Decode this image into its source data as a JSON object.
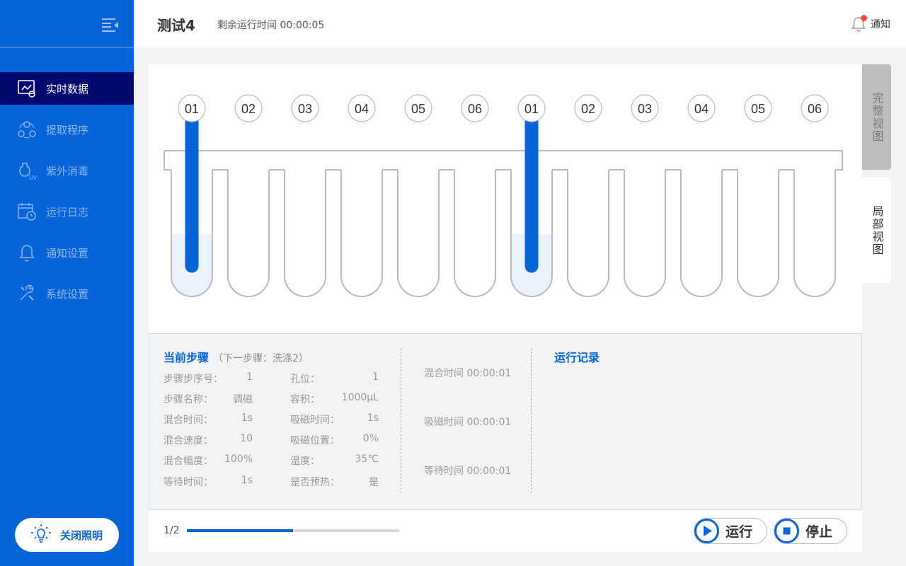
{
  "sidebar": {
    "items": [
      {
        "label": "实时数据",
        "icon": "realtime-data-icon",
        "active": true
      },
      {
        "label": "提取程序",
        "icon": "extraction-program-icon",
        "active": false
      },
      {
        "label": "紫外消毒",
        "icon": "uv-disinfection-icon",
        "active": false
      },
      {
        "label": "运行日志",
        "icon": "calendar-clock-icon",
        "active": false
      },
      {
        "label": "通知设置",
        "icon": "bell-icon",
        "active": false
      },
      {
        "label": "系统设置",
        "icon": "tools-icon",
        "active": false
      }
    ],
    "light_button": "关闭照明"
  },
  "header": {
    "title": "测试4",
    "remaining": "剩余运行时间 00:00:05",
    "notify": "通知"
  },
  "view_tabs": {
    "full": "完整视图",
    "local": "局部视图"
  },
  "wells": {
    "labels": [
      "01",
      "02",
      "03",
      "04",
      "05",
      "06",
      "01",
      "02",
      "03",
      "04",
      "05",
      "06"
    ],
    "active_indices": [
      0,
      6
    ],
    "liquid_indices": [
      0,
      6
    ]
  },
  "step": {
    "title": "当前步骤",
    "next": "（下一步骤：洗涤2）",
    "left": [
      {
        "key": "步骤步序号：",
        "value": "1"
      },
      {
        "key": "步骤名称：",
        "value": "调磁"
      },
      {
        "key": "混合时间：",
        "value": "1s"
      },
      {
        "key": "混合速度：",
        "value": "10"
      },
      {
        "key": "混合幅度：",
        "value": "100%"
      },
      {
        "key": "等待时间：",
        "value": "1s"
      }
    ],
    "right": [
      {
        "key": "孔位：",
        "value": "1"
      },
      {
        "key": "容积：",
        "value": "1000μL"
      },
      {
        "key": "吸磁时间：",
        "value": "1s"
      },
      {
        "key": "吸磁位置：",
        "value": "0%"
      },
      {
        "key": "温度：",
        "value": "35℃"
      },
      {
        "key": "是否预热：",
        "value": "是"
      }
    ]
  },
  "timers": [
    "混合时间 00:00:01",
    "吸磁时间 00:00:01",
    "等待时间 00:00:01"
  ],
  "log_title": "运行记录",
  "footer": {
    "page": "1/2",
    "progress": 0.5,
    "run": "运行",
    "stop": "停止"
  },
  "colors": {
    "primary": "#0565d8",
    "active_nav": "#05096f",
    "liquid": "#eaf3fd"
  }
}
